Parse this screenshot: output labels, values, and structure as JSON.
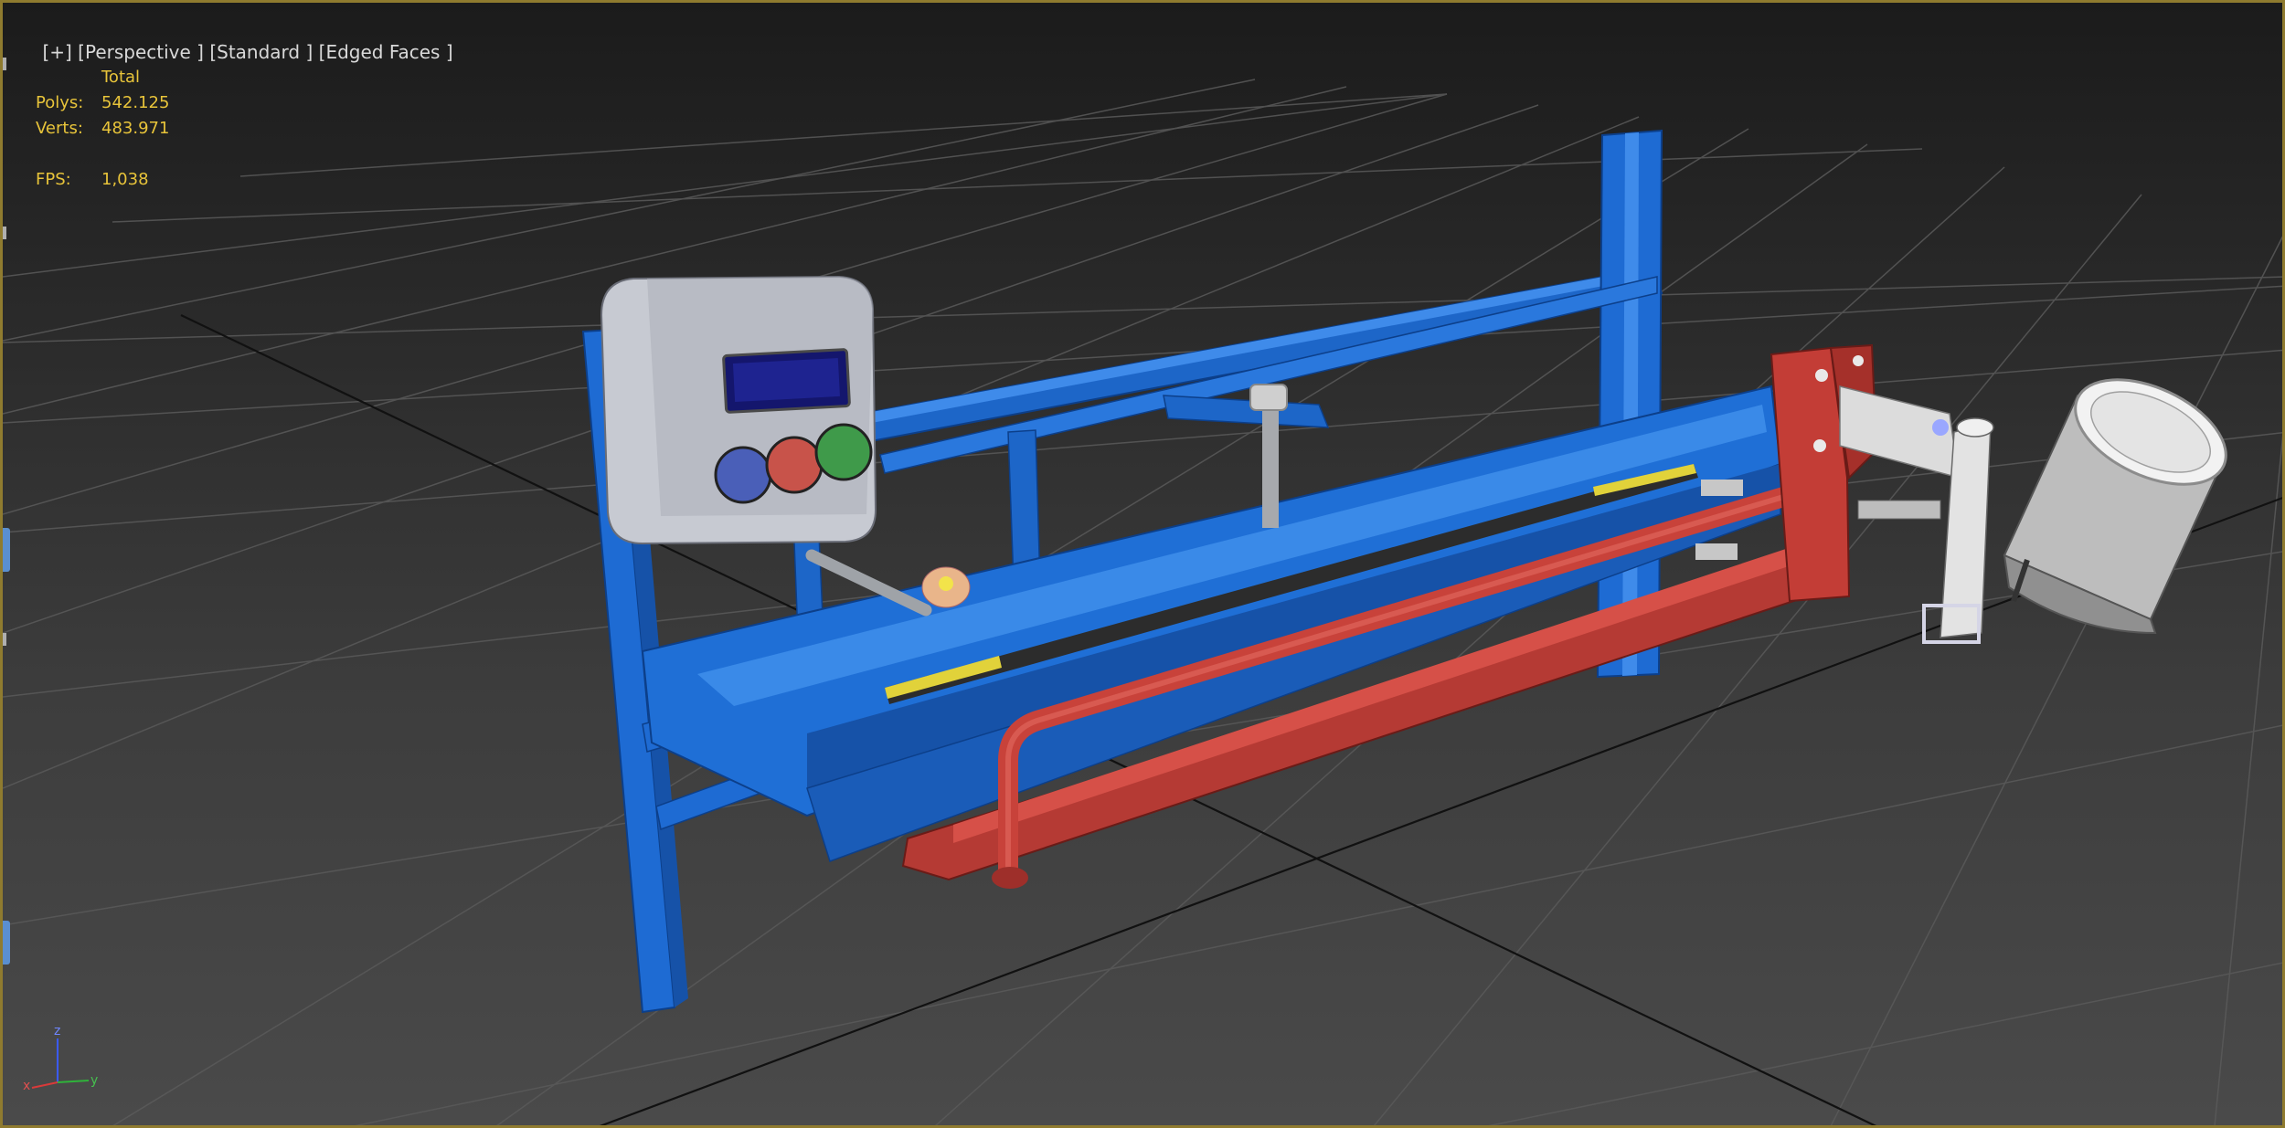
{
  "viewport": {
    "label_plus": "[+]",
    "label_view": "[Perspective ]",
    "label_shading": "[Standard ]",
    "label_edges": "[Edged Faces ]"
  },
  "stats": {
    "header": "Total",
    "polys_label": "Polys:",
    "polys_value": "542.125",
    "verts_label": "Verts:",
    "verts_value": "483.971",
    "fps_label": "FPS:",
    "fps_value": "1,038"
  },
  "axis": {
    "z": "z",
    "x": "x",
    "y": "y"
  },
  "colors": {
    "frame": "#8f7b2f",
    "stats_text": "#e8c43a",
    "frame_blue": "#1f6fd6",
    "pipe_red": "#c8423a",
    "control_box": "#b9bcc4",
    "grid": "#5a5a5a"
  }
}
